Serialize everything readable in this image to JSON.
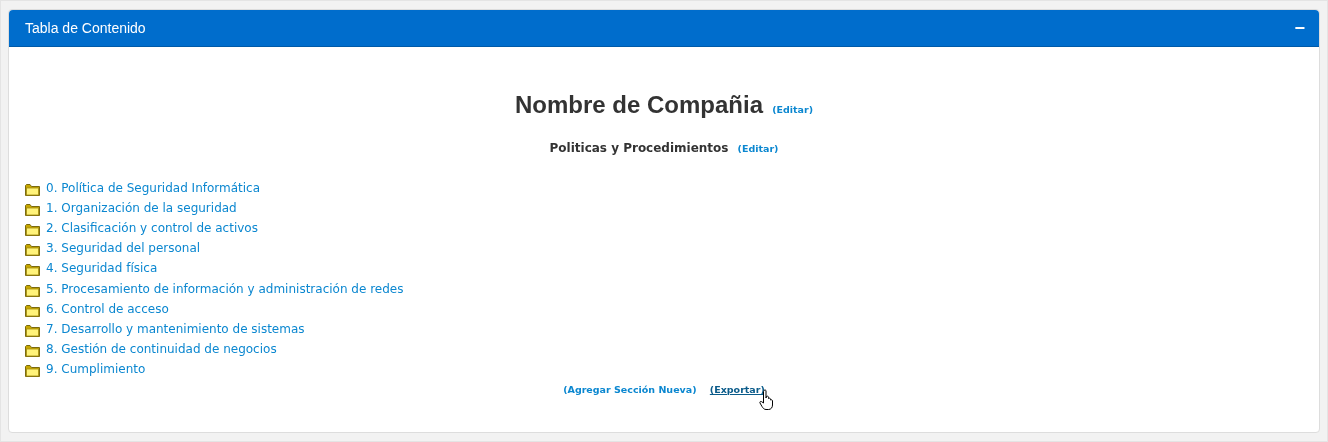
{
  "panel": {
    "title": "Tabla de Contenido",
    "collapse_symbol": "−"
  },
  "company": {
    "name": "Nombre de Compañia",
    "edit_link": "(Editar)"
  },
  "subtitle": {
    "text": "Politicas y Procedimientos",
    "edit_link": "(Editar)"
  },
  "sections": [
    {
      "label": "0. Política de Seguridad Informática"
    },
    {
      "label": "1. Organización de la seguridad"
    },
    {
      "label": "2. Clasificación y control de activos"
    },
    {
      "label": "3. Seguridad del personal"
    },
    {
      "label": "4. Seguridad física"
    },
    {
      "label": "5. Procesamiento de información y administración de redes"
    },
    {
      "label": "6. Control de acceso"
    },
    {
      "label": "7. Desarrollo y mantenimiento de sistemas"
    },
    {
      "label": "8. Gestión de continuidad de negocios"
    },
    {
      "label": "9. Cumplimiento"
    }
  ],
  "actions": [
    {
      "label": "(Agregar Sección Nueva)",
      "hovered": false
    },
    {
      "label": "(Exportar)",
      "hovered": true
    }
  ]
}
